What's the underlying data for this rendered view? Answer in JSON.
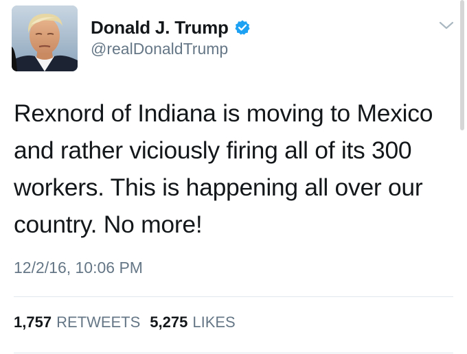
{
  "author": {
    "display_name": "Donald J. Trump",
    "handle": "@realDonaldTrump",
    "verified": true
  },
  "tweet": {
    "text": "Rexnord of Indiana is moving to Mexico and rather viciously firing all of its 300 workers. This is happening all over our country. No more!",
    "timestamp": "12/2/16, 10:06 PM"
  },
  "stats": {
    "retweets_count": "1,757",
    "retweets_label": "RETWEETS",
    "likes_count": "5,275",
    "likes_label": "LIKES"
  },
  "icons": {
    "verified": "verified-badge-icon",
    "menu": "chevron-down-icon"
  },
  "colors": {
    "verified_blue": "#1da1f2",
    "secondary_text": "#657786",
    "primary_text": "#14171a",
    "divider": "#e1e8ed"
  }
}
